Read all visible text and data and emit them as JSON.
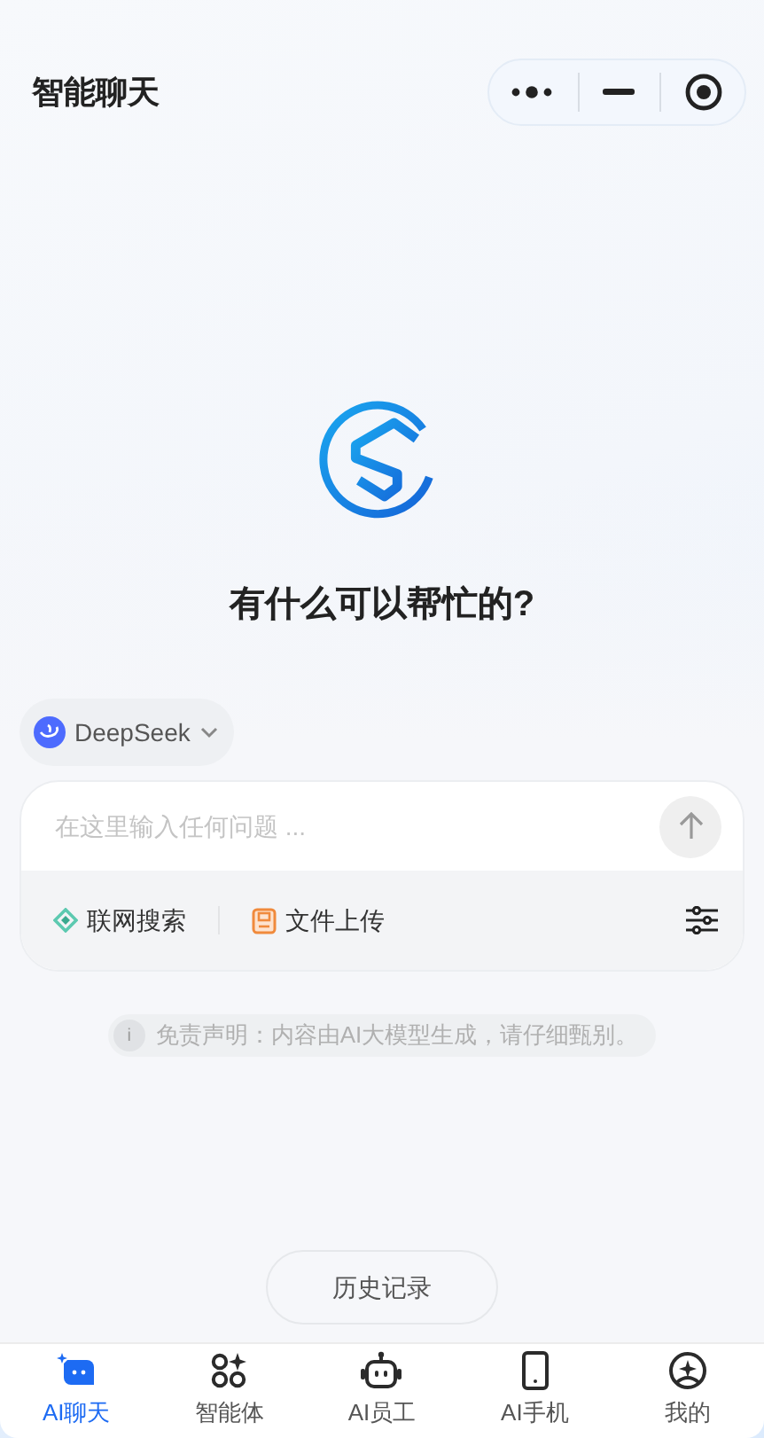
{
  "header": {
    "title": "智能聊天"
  },
  "greeting": "有什么可以帮忙的?",
  "model_selector": {
    "label": "DeepSeek"
  },
  "composer": {
    "placeholder": "在这里输入任何问题 ...",
    "tools": [
      {
        "kind": "search",
        "label": "联网搜索"
      },
      {
        "kind": "upload",
        "label": "文件上传"
      }
    ]
  },
  "disclaimer": {
    "icon": "i",
    "text": "免责声明：内容由AI大模型生成，请仔细甄别。"
  },
  "history_button": {
    "label": "历史记录"
  },
  "tabs": [
    {
      "kind": "chat",
      "label": "AI聊天",
      "selected": true
    },
    {
      "kind": "agents",
      "label": "智能体",
      "selected": false
    },
    {
      "kind": "staff",
      "label": "AI员工",
      "selected": false
    },
    {
      "kind": "phone",
      "label": "AI手机",
      "selected": false
    },
    {
      "kind": "me",
      "label": "我的",
      "selected": false
    }
  ]
}
